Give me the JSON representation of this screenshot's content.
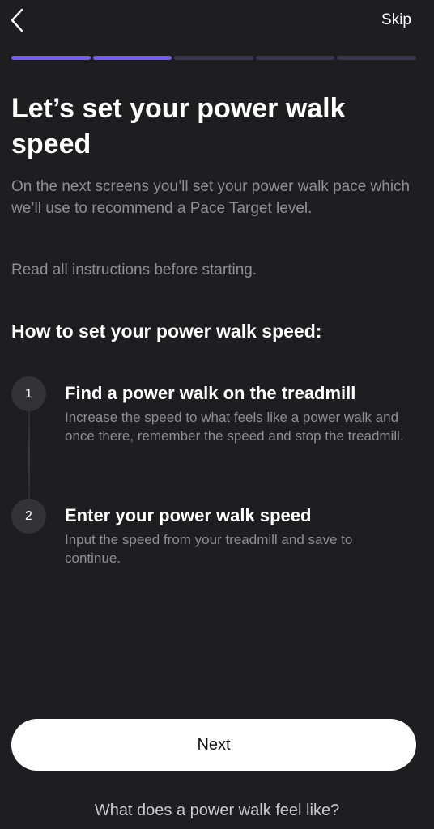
{
  "header": {
    "back_icon": "chevron-left-icon",
    "skip_label": "Skip"
  },
  "progress": {
    "total_steps": 5,
    "completed_steps": 2,
    "active_color": "#7b5cf0",
    "inactive_color": "#3b3550"
  },
  "content": {
    "title": "Let’s set your power walk speed",
    "intro": "On the next screens you’ll set your power walk pace which we’ll use to recommend a Pace Target level.",
    "intro_note": "Read all instructions before starting.",
    "howto_heading": "How to set your power walk speed:"
  },
  "steps": [
    {
      "number": "1",
      "title": "Find a power walk on the treadmill",
      "description": "Increase the speed to what feels like a power walk and once there, remember the speed and stop the treadmill."
    },
    {
      "number": "2",
      "title": "Enter your power walk speed",
      "description": "Input the speed from your treadmill and save to continue."
    }
  ],
  "footer": {
    "next_label": "Next",
    "feel_link": "What does a power walk feel like?"
  }
}
